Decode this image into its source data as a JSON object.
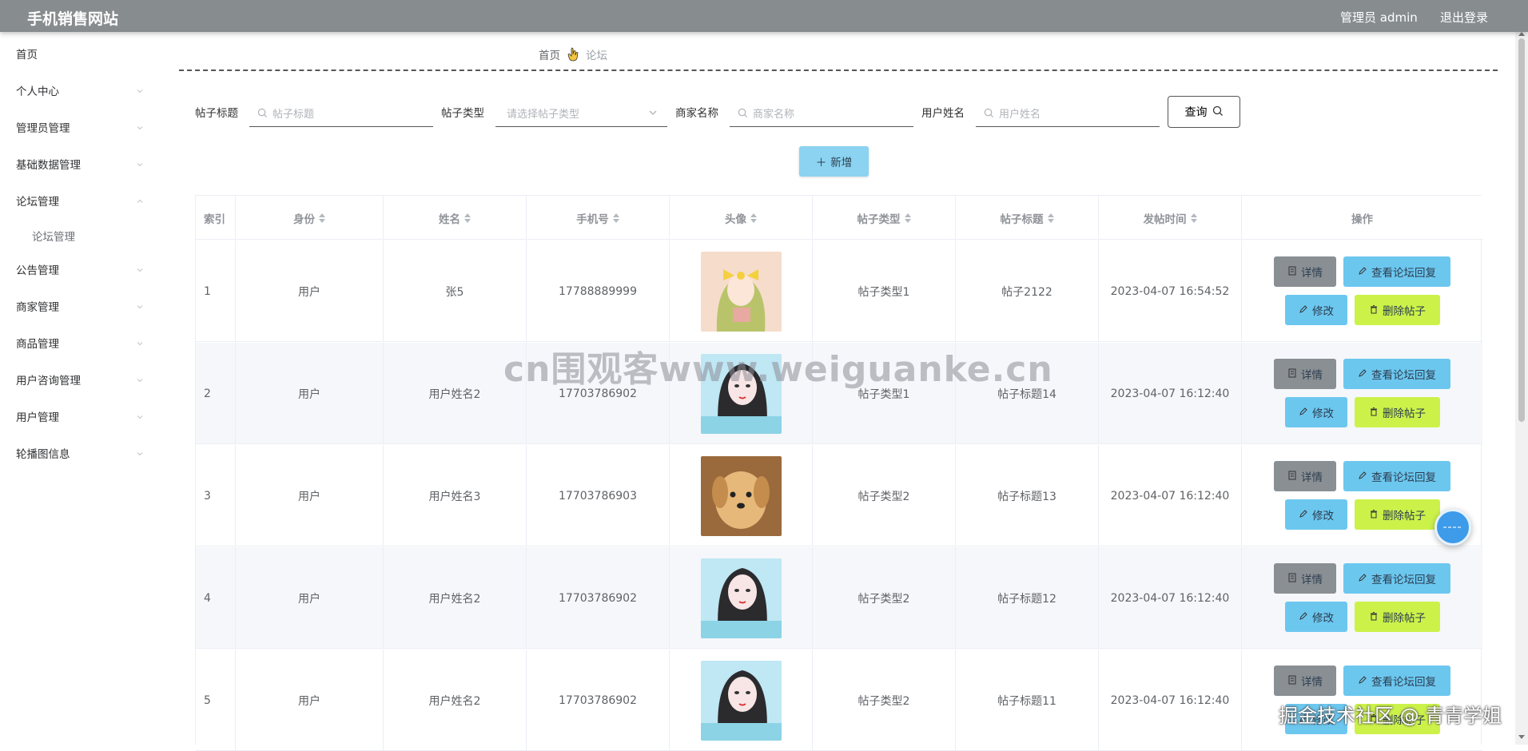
{
  "header": {
    "title": "手机销售网站",
    "admin_label": "管理员 admin",
    "logout_label": "退出登录"
  },
  "sidebar": {
    "items": [
      {
        "label": "首页",
        "expandable": false
      },
      {
        "label": "个人中心",
        "expandable": true
      },
      {
        "label": "管理员管理",
        "expandable": true
      },
      {
        "label": "基础数据管理",
        "expandable": true
      },
      {
        "label": "论坛管理",
        "expandable": true,
        "expanded": true
      },
      {
        "label": "公告管理",
        "expandable": true
      },
      {
        "label": "商家管理",
        "expandable": true
      },
      {
        "label": "商品管理",
        "expandable": true
      },
      {
        "label": "用户咨询管理",
        "expandable": true
      },
      {
        "label": "用户管理",
        "expandable": true
      },
      {
        "label": "轮播图信息",
        "expandable": true
      }
    ],
    "subitems": {
      "forum": "论坛管理"
    }
  },
  "breadcrumb": {
    "home": "首页",
    "current": "论坛"
  },
  "search": {
    "title_label": "帖子标题",
    "title_placeholder": "帖子标题",
    "type_label": "帖子类型",
    "type_placeholder": "请选择帖子类型",
    "merchant_label": "商家名称",
    "merchant_placeholder": "商家名称",
    "user_label": "用户姓名",
    "user_placeholder": "用户姓名",
    "query_label": "查询"
  },
  "add_label": "新增",
  "table": {
    "columns": [
      "索引",
      "身份",
      "姓名",
      "手机号",
      "头像",
      "帖子类型",
      "帖子标题",
      "发帖时间",
      "操作"
    ],
    "rows": [
      {
        "index": "1",
        "identity": "用户",
        "name": "张5",
        "phone": "17788889999",
        "avatar": "anime-girl-yellow-bow",
        "type": "帖子类型1",
        "title": "帖子2122",
        "time": "2023-04-07 16:54:52"
      },
      {
        "index": "2",
        "identity": "用户",
        "name": "用户姓名2",
        "phone": "17703786902",
        "avatar": "anime-girl-dark-hair",
        "type": "帖子类型1",
        "title": "帖子标题14",
        "time": "2023-04-07 16:12:40"
      },
      {
        "index": "3",
        "identity": "用户",
        "name": "用户姓名3",
        "phone": "17703786903",
        "avatar": "puppy",
        "type": "帖子类型2",
        "title": "帖子标题13",
        "time": "2023-04-07 16:12:40"
      },
      {
        "index": "4",
        "identity": "用户",
        "name": "用户姓名2",
        "phone": "17703786902",
        "avatar": "anime-girl-dark-hair",
        "type": "帖子类型2",
        "title": "帖子标题12",
        "time": "2023-04-07 16:12:40"
      },
      {
        "index": "5",
        "identity": "用户",
        "name": "用户姓名2",
        "phone": "17703786902",
        "avatar": "anime-girl-dark-hair",
        "type": "帖子类型2",
        "title": "帖子标题11",
        "time": "2023-04-07 16:12:40"
      }
    ],
    "actions": {
      "detail": "详情",
      "reply": "查看论坛回复",
      "edit": "修改",
      "delete": "删除帖子"
    }
  },
  "watermark": "cn围观客www.weiguanke.cn",
  "corner_watermark": "掘金技术社区 @ 青青学姐",
  "colors": {
    "topbar": "#878c8f",
    "add_button": "#8bd3f0",
    "detail_button": "#8a8f94",
    "reply_button": "#6cc7ef",
    "delete_button": "#ccf24a"
  }
}
